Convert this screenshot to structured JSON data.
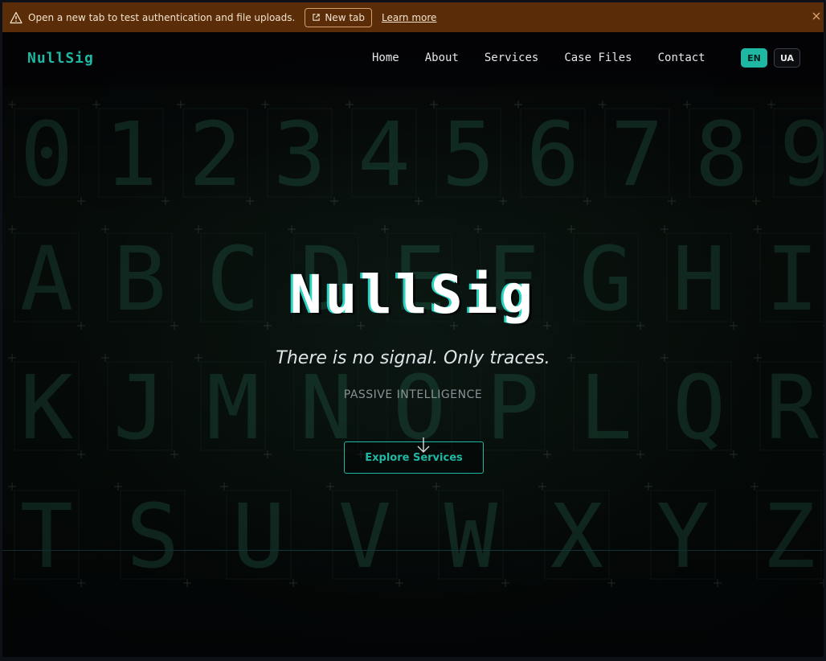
{
  "banner": {
    "message": "Open a new tab to test authentication and file uploads.",
    "new_tab_label": "New tab",
    "learn_more_label": "Learn more"
  },
  "nav": {
    "brand": "NullSig",
    "items": [
      {
        "label": "Home"
      },
      {
        "label": "About"
      },
      {
        "label": "Services"
      },
      {
        "label": "Case Files"
      },
      {
        "label": "Contact"
      }
    ],
    "languages": [
      {
        "code": "EN",
        "active": true
      },
      {
        "code": "UA",
        "active": false
      }
    ]
  },
  "hero": {
    "title": "NullSig",
    "tagline": "There is no signal. Only traces.",
    "subtitle": "PASSIVE INTELLIGENCE",
    "cta_label": "Explore Services"
  },
  "background_glyphs": {
    "row1": [
      "0",
      "1",
      "2",
      "3",
      "4",
      "5",
      "6",
      "7",
      "8",
      "9"
    ],
    "row2": [
      "A",
      "B",
      "C",
      "D",
      "E",
      "F",
      "G",
      "H",
      "I"
    ],
    "row3": [
      "K",
      "J",
      "M",
      "N",
      "O",
      "P",
      "L",
      "Q",
      "R"
    ],
    "row4": [
      "T",
      "S",
      "U",
      "V",
      "W",
      "X",
      "Y",
      "Z"
    ]
  },
  "colors": {
    "accent": "#1fb8a3",
    "banner_bg": "#5a2d08",
    "glyph": "#1d4a3a"
  }
}
